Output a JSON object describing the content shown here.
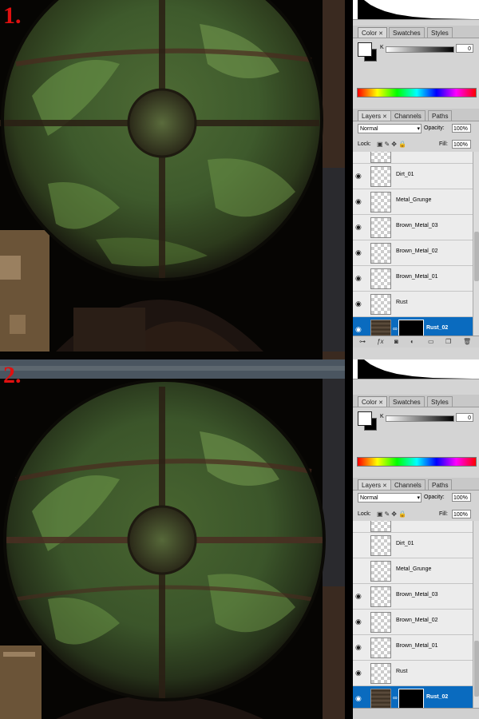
{
  "steps": [
    {
      "label": "1.",
      "panel": {
        "color_tabs": [
          "Color",
          "Swatches",
          "Styles"
        ],
        "k_channel": "K",
        "k_value": "0",
        "layers_tabs": [
          "Layers",
          "Channels",
          "Paths"
        ],
        "blend_mode": "Normal",
        "opacity_label": "Opacity:",
        "opacity_value": "100%",
        "lock_label": "Lock:",
        "fill_label": "Fill:",
        "fill_value": "100%",
        "layers": [
          "Dirt_01",
          "Metal_Grunge",
          "Brown_Metal_03",
          "Brown_Metal_02",
          "Brown_Metal_01",
          "Rust",
          "Rust_02"
        ],
        "selected_layer": "Rust_02"
      }
    },
    {
      "label": "2.",
      "panel": {
        "color_tabs": [
          "Color",
          "Swatches",
          "Styles"
        ],
        "k_channel": "K",
        "k_value": "0",
        "layers_tabs": [
          "Layers",
          "Channels",
          "Paths"
        ],
        "blend_mode": "Normal",
        "opacity_label": "Opacity:",
        "opacity_value": "100%",
        "lock_label": "Lock:",
        "fill_label": "Fill:",
        "fill_value": "100%",
        "layers": [
          "Dirt_01",
          "Metal_Grunge",
          "Brown_Metal_03",
          "Brown_Metal_02",
          "Brown_Metal_01",
          "Rust",
          "Rust_02"
        ],
        "selected_layer": "Rust_02"
      }
    }
  ],
  "icons": {
    "close_tab": "close-icon",
    "eye": "eye-icon",
    "chain": "link-icon",
    "footer": [
      "link-layers-icon",
      "fx-icon",
      "mask-icon",
      "adjustment-icon",
      "group-icon",
      "new-layer-icon",
      "trash-icon"
    ]
  },
  "colors": {
    "selected_layer": "#0a6bbf",
    "step_label": "#e01010",
    "panel_bg": "#d4d4d4"
  }
}
